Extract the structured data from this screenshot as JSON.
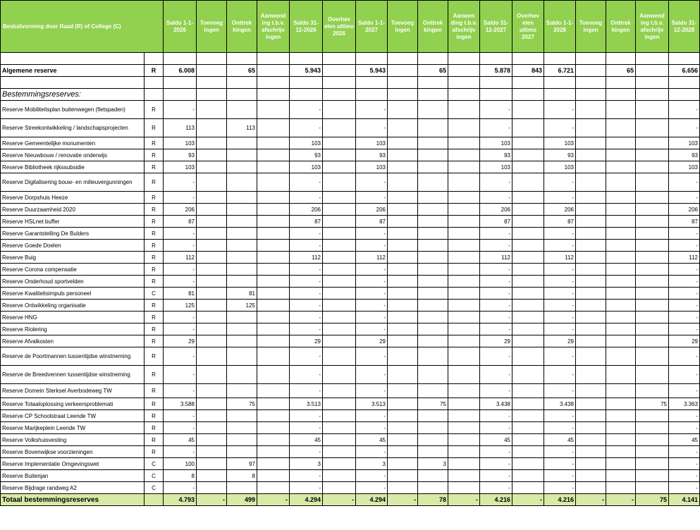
{
  "header": {
    "first": "Besluitvorming door Raad (R) of College (C)",
    "cols": [
      "Saldo 1-1-2026",
      "Toevoeg ingen",
      "Onttrek kingen",
      "Aanwend ing t.b.v. afschrijv ingen",
      "Saldo 31-12-2026",
      "Overhev elen ultimo 2026",
      "Saldo 1-1-2027",
      "Toevoeg ingen",
      "Onttrek kingen",
      "Aanwen ding t.b.v. afschrijv ingen",
      "Saldo 31-12-2027",
      "Overhev elen ultimo 2027",
      "Saldo 1-1-2028",
      "Toevoeg ingen",
      "Onttrek kingen",
      "Aanwend ing t.b.v. afschrijv ingen",
      "Saldo 31-12-2028"
    ]
  },
  "algemene": {
    "name": "Algemene reserve",
    "rc": "R",
    "v": [
      "6.008",
      "",
      "65",
      "",
      "5.943",
      "",
      "5.943",
      "",
      "65",
      "",
      "5.878",
      "843",
      "6.721",
      "",
      "65",
      "",
      "6.656"
    ]
  },
  "section_title": "Bestemmingsreserves:",
  "rows": [
    {
      "name": "Reserve Mobiliteitsplan buitenwegen (fietspaden)",
      "rc": "R",
      "v": [
        "-",
        "",
        "",
        "",
        "-",
        "",
        "-",
        "",
        "",
        "",
        "-",
        "",
        "-",
        "",
        "",
        "",
        "-"
      ]
    },
    {
      "name": "Reserve Streekontwikkeling / landschapsprojecten",
      "rc": "R",
      "v": [
        "113",
        "",
        "113",
        "",
        "-",
        "",
        "-",
        "",
        "",
        "",
        "-",
        "",
        "-",
        "",
        "",
        "",
        "-"
      ]
    },
    {
      "name": "Reserve Gemeentelijke monumenten",
      "rc": "R",
      "v": [
        "103",
        "",
        "",
        "",
        "103",
        "",
        "103",
        "",
        "",
        "",
        "103",
        "",
        "103",
        "",
        "",
        "",
        "103"
      ]
    },
    {
      "name": "Reserve Nieuwbouw / renovatie onderwijs",
      "rc": "R",
      "v": [
        "93",
        "",
        "",
        "",
        "93",
        "",
        "93",
        "",
        "",
        "",
        "93",
        "",
        "93",
        "",
        "",
        "",
        "93"
      ]
    },
    {
      "name": "Reserve Bibliotheek rijkssubsidie",
      "rc": "R",
      "v": [
        "103",
        "",
        "",
        "",
        "103",
        "",
        "103",
        "",
        "",
        "",
        "103",
        "",
        "103",
        "",
        "",
        "",
        "103"
      ]
    },
    {
      "name": "Reserve Digitalisering bouw- en milieuvergunningen",
      "rc": "R",
      "v": [
        "-",
        "",
        "",
        "",
        "-",
        "",
        "-",
        "",
        "",
        "",
        "-",
        "",
        "-",
        "",
        "",
        "",
        "-"
      ]
    },
    {
      "name": "Reserve Dorpshuis Heeze",
      "rc": "R",
      "v": [
        "-",
        "",
        "",
        "",
        "-",
        "",
        "-",
        "",
        "",
        "",
        "-",
        "",
        "-",
        "",
        "",
        "",
        "-"
      ]
    },
    {
      "name": "Reserve Duurzaamheid 2020",
      "rc": "R",
      "v": [
        "206",
        "",
        "",
        "",
        "206",
        "",
        "206",
        "",
        "",
        "",
        "206",
        "",
        "206",
        "",
        "",
        "",
        "206"
      ]
    },
    {
      "name": "Reserve HSLnet buffer",
      "rc": "R",
      "v": [
        "87",
        "",
        "",
        "",
        "87",
        "",
        "87",
        "",
        "",
        "",
        "87",
        "",
        "87",
        "",
        "",
        "",
        "87"
      ]
    },
    {
      "name": "Reserve Garantstelling De Bulders",
      "rc": "R",
      "v": [
        "-",
        "",
        "",
        "",
        "-",
        "",
        "-",
        "",
        "",
        "",
        "-",
        "",
        "-",
        "",
        "",
        "",
        "-"
      ]
    },
    {
      "name": "Reserve Goede Doelen",
      "rc": "R",
      "v": [
        "-",
        "",
        "",
        "",
        "-",
        "",
        "-",
        "",
        "",
        "",
        "-",
        "",
        "-",
        "",
        "",
        "",
        "-"
      ]
    },
    {
      "name": "Reserve Buig",
      "rc": "R",
      "v": [
        "112",
        "",
        "",
        "",
        "112",
        "",
        "112",
        "",
        "",
        "",
        "112",
        "",
        "112",
        "",
        "",
        "",
        "112"
      ]
    },
    {
      "name": "Reserve Corona compensatie",
      "rc": "R",
      "v": [
        "-",
        "",
        "",
        "",
        "-",
        "",
        "-",
        "",
        "",
        "",
        "-",
        "",
        "-",
        "",
        "",
        "",
        "-"
      ]
    },
    {
      "name": "Reserve Onderhoud sportvelden",
      "rc": "R",
      "v": [
        "-",
        "",
        "",
        "",
        "-",
        "",
        "-",
        "",
        "",
        "",
        "-",
        "",
        "-",
        "",
        "",
        "",
        "-"
      ]
    },
    {
      "name": "Reserve Kwaliteitsimpuls personeel",
      "rc": "C",
      "v": [
        "81",
        "",
        "81",
        "",
        "-",
        "",
        "-",
        "",
        "",
        "",
        "-",
        "",
        "-",
        "",
        "",
        "",
        "-"
      ]
    },
    {
      "name": "Reserve Ontwikkeling organisatie",
      "rc": "R",
      "v": [
        "125",
        "",
        "125",
        "",
        "-",
        "",
        "-",
        "",
        "",
        "",
        "-",
        "",
        "-",
        "",
        "",
        "",
        "-"
      ]
    },
    {
      "name": "Reserve HNG",
      "rc": "R",
      "v": [
        "-",
        "",
        "",
        "",
        "-",
        "",
        "-",
        "",
        "",
        "",
        "-",
        "",
        "-",
        "",
        "",
        "",
        "-"
      ]
    },
    {
      "name": "Reserve Riolering",
      "rc": "R",
      "v": [
        "-",
        "",
        "",
        "",
        "-",
        "",
        "-",
        "",
        "",
        "",
        "-",
        "",
        "-",
        "",
        "",
        "",
        "-"
      ]
    },
    {
      "name": "Reserve Afvalkosten",
      "rc": "R",
      "v": [
        "29",
        "",
        "",
        "",
        "29",
        "",
        "29",
        "",
        "",
        "",
        "29",
        "",
        "29",
        "",
        "",
        "",
        "29"
      ]
    },
    {
      "name": "Reserve de Poortmannen tussentijdse winstneming",
      "rc": "R",
      "v": [
        "-",
        "",
        "",
        "",
        "-",
        "",
        "-",
        "",
        "",
        "",
        "-",
        "",
        "-",
        "",
        "",
        "",
        "-"
      ]
    },
    {
      "name": "Reserve de Breedvennen tussentijdse winstneming",
      "rc": "R",
      "v": [
        "-",
        "",
        "",
        "",
        "-",
        "",
        "-",
        "",
        "",
        "",
        "-",
        "",
        "-",
        "",
        "",
        "",
        "-"
      ]
    },
    {
      "name": "Reserve Domein Sterksel Averbodeweg TW",
      "rc": "R",
      "v": [
        "-",
        "",
        "",
        "",
        "-",
        "",
        "-",
        "",
        "",
        "",
        "-",
        "",
        "-",
        "",
        "",
        "",
        "-"
      ]
    },
    {
      "name": "Reserve Totaaloplossing verkeersproblemati",
      "rc": "R",
      "v": [
        "3.588",
        "",
        "75",
        "",
        "3.513",
        "",
        "3.513",
        "",
        "75",
        "",
        "3.438",
        "",
        "3.438",
        "",
        "",
        "75",
        "3.363"
      ]
    },
    {
      "name": "Reserve CP Schoolstraat Leende TW",
      "rc": "R",
      "v": [
        "-",
        "",
        "",
        "",
        "-",
        "",
        "-",
        "",
        "",
        "",
        "-",
        "",
        "-",
        "",
        "",
        "",
        "-"
      ]
    },
    {
      "name": "Reserve Marijkeplein Leende TW",
      "rc": "R",
      "v": [
        "-",
        "",
        "",
        "",
        "-",
        "",
        "-",
        "",
        "",
        "",
        "-",
        "",
        "-",
        "",
        "",
        "",
        "-"
      ]
    },
    {
      "name": "Reserve Volkshuisvesting",
      "rc": "R",
      "v": [
        "45",
        "",
        "",
        "",
        "45",
        "",
        "45",
        "",
        "",
        "",
        "45",
        "",
        "45",
        "",
        "",
        "",
        "45"
      ]
    },
    {
      "name": "Reserve Bovenwijkse voorzieningen",
      "rc": "R",
      "v": [
        "-",
        "",
        "",
        "",
        "-",
        "",
        "-",
        "",
        "",
        "",
        "-",
        "",
        "-",
        "",
        "",
        "",
        "-"
      ]
    },
    {
      "name": "Reserve Implementatie Omgevingswet",
      "rc": "C",
      "v": [
        "100",
        "",
        "97",
        "",
        "3",
        "",
        "3",
        "",
        "3",
        "",
        "-",
        "",
        "-",
        "",
        "",
        "",
        "-"
      ]
    },
    {
      "name": "Reserve Buitenjan",
      "rc": "C",
      "v": [
        "8",
        "",
        "8",
        "",
        "-",
        "",
        "-",
        "",
        "",
        "",
        "-",
        "",
        "-",
        "",
        "",
        "",
        "-"
      ]
    },
    {
      "name": "Reserve Bijdrage randweg A2",
      "rc": "C",
      "v": [
        "-",
        "",
        "",
        "",
        "-",
        "",
        "-",
        "",
        "",
        "",
        "-",
        "",
        "-",
        "",
        "",
        "",
        "-"
      ]
    }
  ],
  "total": {
    "name": "Totaal bestemmingsreserves",
    "rc": "",
    "v": [
      "4.793",
      "-",
      "499",
      "-",
      "4.294",
      "-",
      "4.294",
      "-",
      "78",
      "-",
      "4.216",
      "-",
      "4.216",
      "-",
      "-",
      "75",
      "4.141"
    ]
  },
  "colors": {
    "header_bg": "#92d050",
    "total_bg": "#d8e9a8"
  }
}
